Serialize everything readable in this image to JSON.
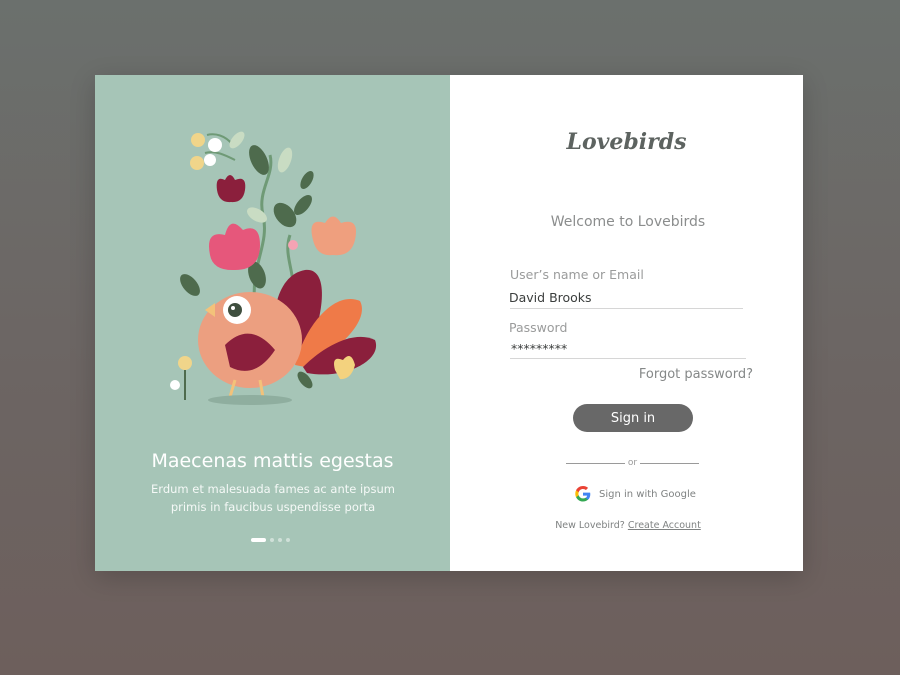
{
  "carousel": {
    "title": "Maecenas mattis egestas",
    "text": "Erdum et malesuada fames ac ante ipsum primis in faucibus uspendisse porta",
    "dot_count": 4,
    "active_dot": 1
  },
  "brand": {
    "logo": "Lovebirds"
  },
  "login": {
    "welcome": "Welcome to Lovebirds",
    "username_label": "User’s name or Email",
    "username_value": "David Brooks",
    "password_label": "Password",
    "password_value": "*********",
    "forgot_label": "Forgot password?",
    "signin_label": "Sign in",
    "or_label": "or",
    "google_label": "Sign in with Google",
    "new_prompt": "New Lovebird?",
    "create_label": "Create Account"
  },
  "colors": {
    "panel_green": "#a6c5b7",
    "button_gray": "#686868",
    "text_gray": "#8b8d8d"
  },
  "icons": {
    "illustration": "bird-with-flowers",
    "google": "google-g-icon"
  }
}
